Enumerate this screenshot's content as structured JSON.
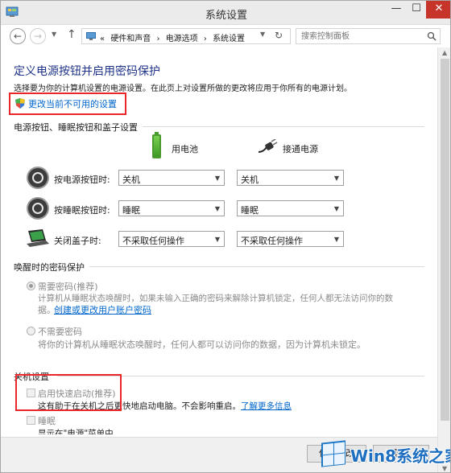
{
  "window": {
    "title": "系统设置",
    "controls": {
      "minimize": "—",
      "maximize": "☐",
      "close": "✕"
    }
  },
  "navbar": {
    "breadcrumbs": [
      "«",
      "硬件和声音",
      "›",
      "电源选项",
      "›",
      "系统设置"
    ],
    "search_placeholder": "搜索控制面板"
  },
  "page": {
    "title": "定义电源按钮并启用密码保护",
    "description": "选择要为你的计算机设置的电源设置。在此页上对设置所做的更改将应用于你所有的电源计划。",
    "change_link": "更改当前不可用的设置"
  },
  "power_section": {
    "heading": "电源按钮、睡眠按钮和盖子设置",
    "col_battery": "用电池",
    "col_plugged": "接通电源",
    "rows": [
      {
        "label": "按电源按钮时:",
        "battery": "关机",
        "plugged": "关机"
      },
      {
        "label": "按睡眠按钮时:",
        "battery": "睡眠",
        "plugged": "睡眠"
      },
      {
        "label": "关闭盖子时:",
        "battery": "不采取任何操作",
        "plugged": "不采取任何操作"
      }
    ]
  },
  "password_section": {
    "heading": "唤醒时的密码保护",
    "require_label": "需要密码(推荐)",
    "require_desc": "计算机从睡眠状态唤醒时，如果未输入正确的密码来解除计算机锁定，任何人都无法访问你的数",
    "require_desc2": "据。",
    "account_link": "创建或更改用户账户密码",
    "no_require_label": "不需要密码",
    "no_require_desc": "将你的计算机从睡眠状态唤醒时，任何人都可以访问你的数据，因为计算机未锁定。"
  },
  "shutdown_section": {
    "heading": "关机设置",
    "fast_startup_label": "启用快速启动(推荐)",
    "fast_startup_desc": "这有助于在关机之后更快地启动电脑。不会影响重启。",
    "learn_more": "了解更多信息",
    "sleep_label": "睡眠",
    "sleep_desc": "显示在\"电源\"菜单中。"
  },
  "footer": {
    "save_button": "保存修改",
    "cancel_button": "取消"
  },
  "watermark": {
    "text": "Win8系统之家"
  },
  "colors": {
    "title_blue": "#1e3287",
    "link_blue": "#0066cc",
    "highlight_red": "#e8262c",
    "close_red": "#c7342a"
  }
}
